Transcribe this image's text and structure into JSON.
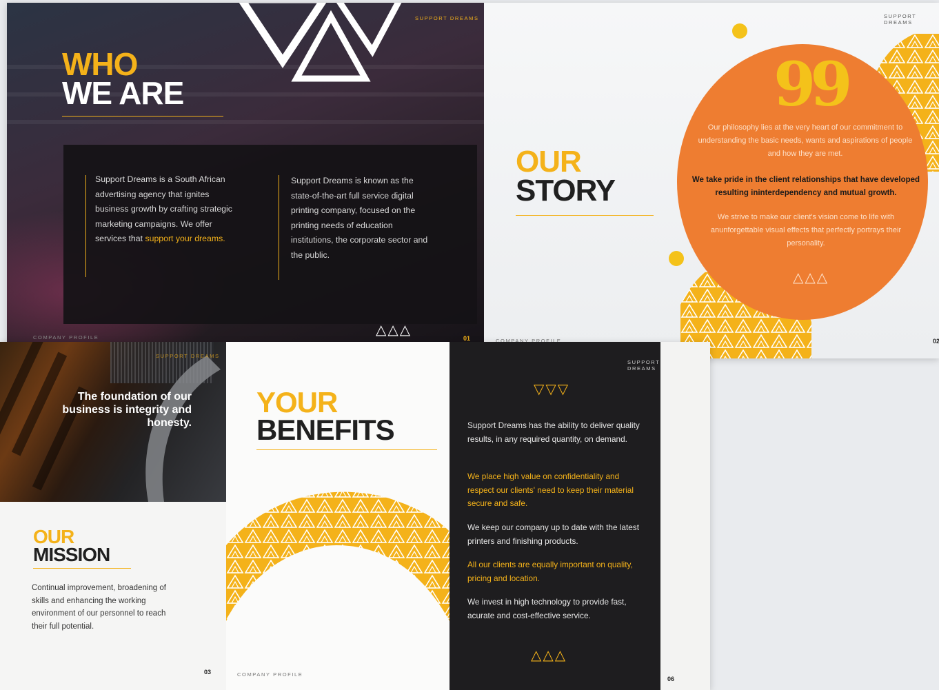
{
  "spread1": {
    "who_heading_line1": "WHO",
    "who_heading_line2": "WE ARE",
    "brand_label": "SUPPORT DREAMS",
    "col1_text": "Support Dreams is a South African advertising agency that ignites business growth by crafting strategic marketing campaigns. We offer services that ",
    "col1_highlight": "support your dreams.",
    "col2_text": "Support Dreams is known as the state-of-the-art full service digital printing company, focused on the printing needs of education institutions, the corporate sector and the public.",
    "triangles": "△△△",
    "footer_label": "COMPANY PROFILE",
    "page_left": "01",
    "story_heading_line1": "OUR",
    "story_heading_line2": "STORY",
    "quote_mark": "99",
    "quote_p1": "Our philosophy lies at the very heart of our commitment to understanding the basic needs, wants and aspirations of people and how they are met.",
    "quote_p2": "We take pride in the client relationships that have developed resulting ininterdependency and mutual growth.",
    "quote_p3": "We strive to make our client's vision come to life with anunforgettable visual effects that perfectly portrays their personality.",
    "page_right": "02"
  },
  "spread2": {
    "brand_label": "SUPPORT DREAMS",
    "tiger_quote": "The foundation of our business is integrity and honesty.",
    "mission_heading_line1": "OUR",
    "mission_heading_line2": "MISSION",
    "mission_text": "Continual improvement, broadening of skills and enhancing the working environment of our personnel to reach their full potential.",
    "page_left": "03",
    "benefits_heading_line1": "YOUR",
    "benefits_heading_line2": "BENEFITS",
    "footer_label": "COMPANY PROFILE",
    "triangles_down": "▽▽▽",
    "benefits": [
      "Support Dreams has the ability to deliver quality results, in any required quantity, on demand.",
      "We place high value on confidentiality and respect our clients' need to keep their material secure and safe.",
      "We keep our company up to date with the latest printers and finishing products.",
      "All our clients are equally important on quality, pricing and location.",
      "We invest in high technology to provide fast, acurate and cost-effective service."
    ],
    "triangles_up": "△△△",
    "page_right": "06"
  },
  "colors": {
    "accent_yellow": "#f4b21a",
    "orange": "#ee7d31",
    "dark": "#1e1d1f"
  }
}
